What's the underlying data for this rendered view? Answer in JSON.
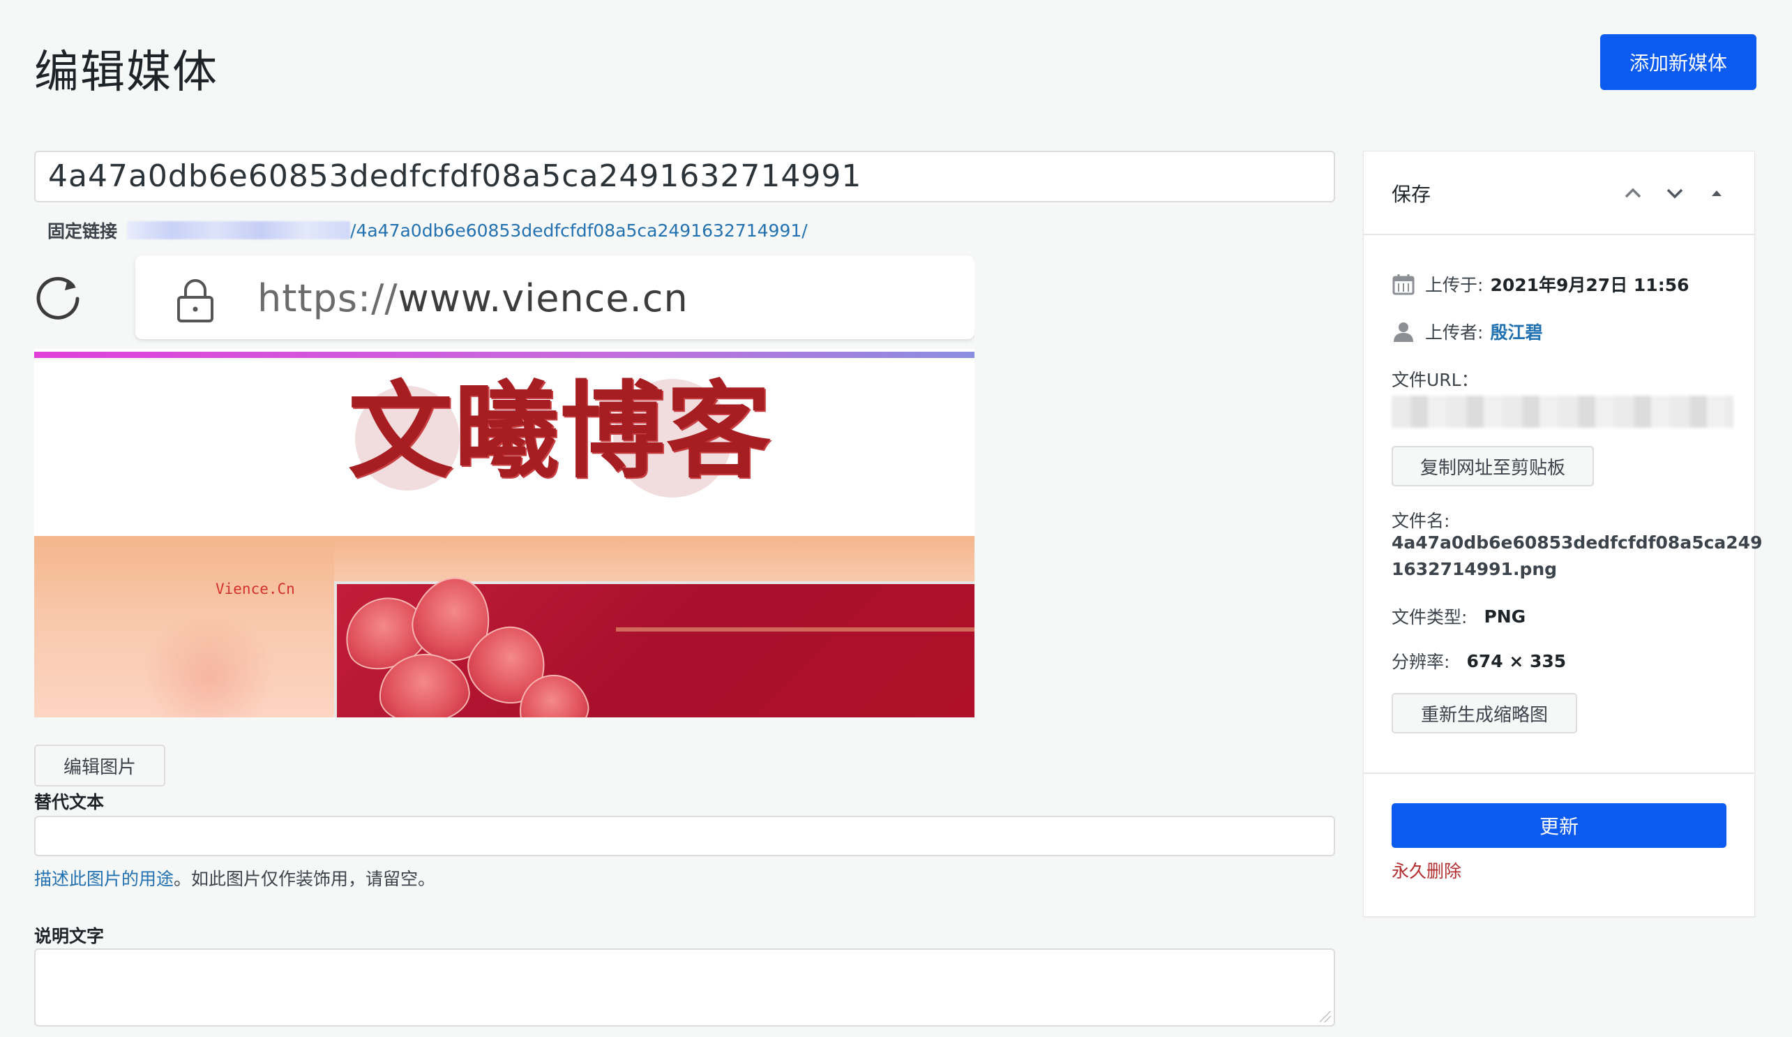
{
  "page": {
    "title": "编辑媒体",
    "add_new_label": "添加新媒体"
  },
  "media": {
    "title_value": "4a47a0db6e60853dedfcfdf08a5ca2491632714991",
    "permalink_label": "固定链接",
    "permalink_visible": "/4a47a0db6e60853dedfcfdf08a5ca2491632714991/"
  },
  "preview": {
    "url_scheme": "https://",
    "url_host": "www.vience.cn",
    "logo_text": "文曦博客",
    "watermark": "Vience.Cn"
  },
  "edit_image_label": "编辑图片",
  "alt_text": {
    "label": "替代文本",
    "value": "",
    "help_link": "描述此图片的用途",
    "help_rest": "。如此图片仅作装饰用，请留空。"
  },
  "caption": {
    "label": "说明文字",
    "value": ""
  },
  "sidebar": {
    "title": "保存",
    "uploaded_label": "上传于:",
    "uploaded_value": "2021年9月27日 11:56",
    "uploader_label": "上传者:",
    "uploader_value": "殷江碧",
    "file_url_label": "文件URL：",
    "copy_label": "复制网址至剪贴板",
    "file_name_label": "文件名:",
    "file_name_line1": "4a47a0db6e60853dedfcfdf08a5ca249",
    "file_name_line2": "1632714991.png",
    "file_type_label": "文件类型:",
    "file_type_value": "PNG",
    "resolution_label": "分辨率:",
    "resolution_value": "674 × 335",
    "regen_label": "重新生成缩略图",
    "update_label": "更新",
    "delete_label": "永久删除"
  },
  "colors": {
    "primary": "#0b5bf0",
    "link": "#2271b1",
    "danger": "#b32d2e"
  }
}
